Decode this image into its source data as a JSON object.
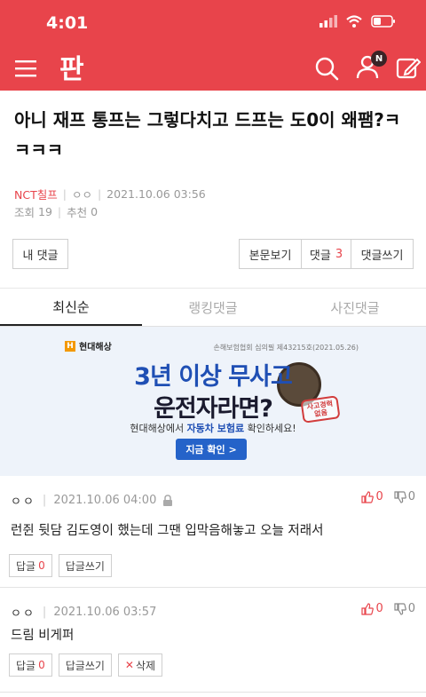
{
  "status_bar": {
    "time": "4:01"
  },
  "nav": {
    "logo": "판",
    "badge": "N"
  },
  "post": {
    "title": "아니 재프 통프는 그렇다치고 드프는 도0이 왜팸?ㅋㅋㅋㅋ",
    "author": "NCT칠프",
    "author_sub": "ㅇㅇ",
    "datetime": "2021.10.06 03:56",
    "views_label": "조회",
    "views": "19",
    "likes_label": "추천",
    "likes": "0"
  },
  "buttons": {
    "my_comments": "내 댓글",
    "view_post": "본문보기",
    "comments": "댓글",
    "comment_count": "3",
    "write_comment": "댓글쓰기"
  },
  "tabs": [
    {
      "label": "최신순",
      "active": true
    },
    {
      "label": "랭킹댓글",
      "active": false
    },
    {
      "label": "사진댓글",
      "active": false
    }
  ],
  "ad": {
    "brand": "현대해상",
    "brand_icon": "H",
    "cert": "손해보험협회 심의필 제43215호(2021.05.26)",
    "headline1": "3년 이상 무사고",
    "headline2": "운전자라면?",
    "stamp": "사고경력 없음",
    "sub_pre": "현대해상에서 ",
    "sub_hl": "자동차 보험료",
    "sub_post": " 확인하세요!",
    "cta": "지금 확인 >"
  },
  "comments": [
    {
      "name": "ㅇㅇ",
      "datetime": "2021.10.06 04:00",
      "up": "0",
      "down": "0",
      "text": "런쥔 뒷담 김도영이 했는데 그땐 입막음해놓고 오늘 저래서",
      "reply_label": "답글",
      "reply_count": "0",
      "write_reply": "답글쓰기"
    },
    {
      "name": "ㅇㅇ",
      "datetime": "2021.10.06 03:57",
      "up": "0",
      "down": "0",
      "text": "드림 비게퍼",
      "reply_label": "답글",
      "reply_count": "0",
      "write_reply": "답글쓰기",
      "delete_label": "삭제",
      "delete_icon": "✕"
    }
  ]
}
